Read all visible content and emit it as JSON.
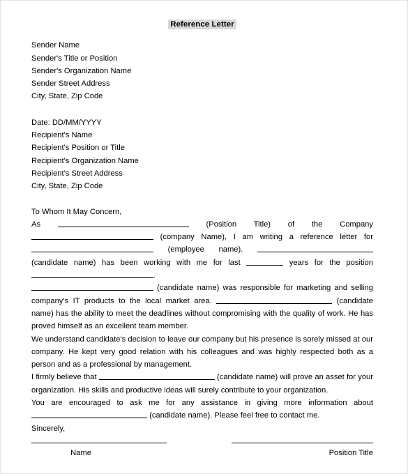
{
  "document": {
    "title": "Reference Letter",
    "sender_block": [
      "Sender Name",
      "Sender's Title or Position",
      "Sender's Organization Name",
      "Sender Street Address",
      "City, State, Zip Code"
    ],
    "recipient_block": [
      "Date: DD/MM/YYYY",
      "Recipient's Name",
      "Recipient's Position or Title",
      "Recipient's Organization Name",
      "Recipient's Street Address",
      "City, State, Zip Code"
    ],
    "salutation": "To Whom It May Concern,",
    "paragraph_1": {
      "t1": "As ",
      "t2": " (Position Title) of the Company ",
      "t3": " (company Name), I am writing a reference letter for ",
      "t4": " (employee name). ",
      "t5": " (candidate name) has been working with me for last ",
      "t6": " years for the position ",
      "t7": "."
    },
    "paragraph_2": {
      "t1": "",
      "t2": " (candidate name) was responsible for marketing and selling company's IT products to the local market area. ",
      "t3": " (candidate name) has the ability to meet the deadlines without compromising with the quality of work. He has proved himself as an excellent team member."
    },
    "paragraph_3": "We understand candidate's decision to leave our company but his presence is sorely missed at our company. He kept very good relation with his colleagues and was highly respected both as a person and as a professional by management.",
    "paragraph_4": {
      "t1": "I firmly believe that ",
      "t2": " (candidate name) will prove an asset for your organization. His skills and productive ideas will surely contribute to your organization."
    },
    "paragraph_5": {
      "t1": "You are encouraged to ask me for any assistance in giving more information about ",
      "t2": " (candidate name). Please feel free to contact me."
    },
    "closing": "Sincerely,",
    "signature": {
      "name_label": "Name",
      "position_label": "Position Title"
    }
  },
  "style": {
    "highlight_color": "#d9d9d9",
    "text_color": "#000000",
    "page_border_color": "#e3e3e3"
  }
}
